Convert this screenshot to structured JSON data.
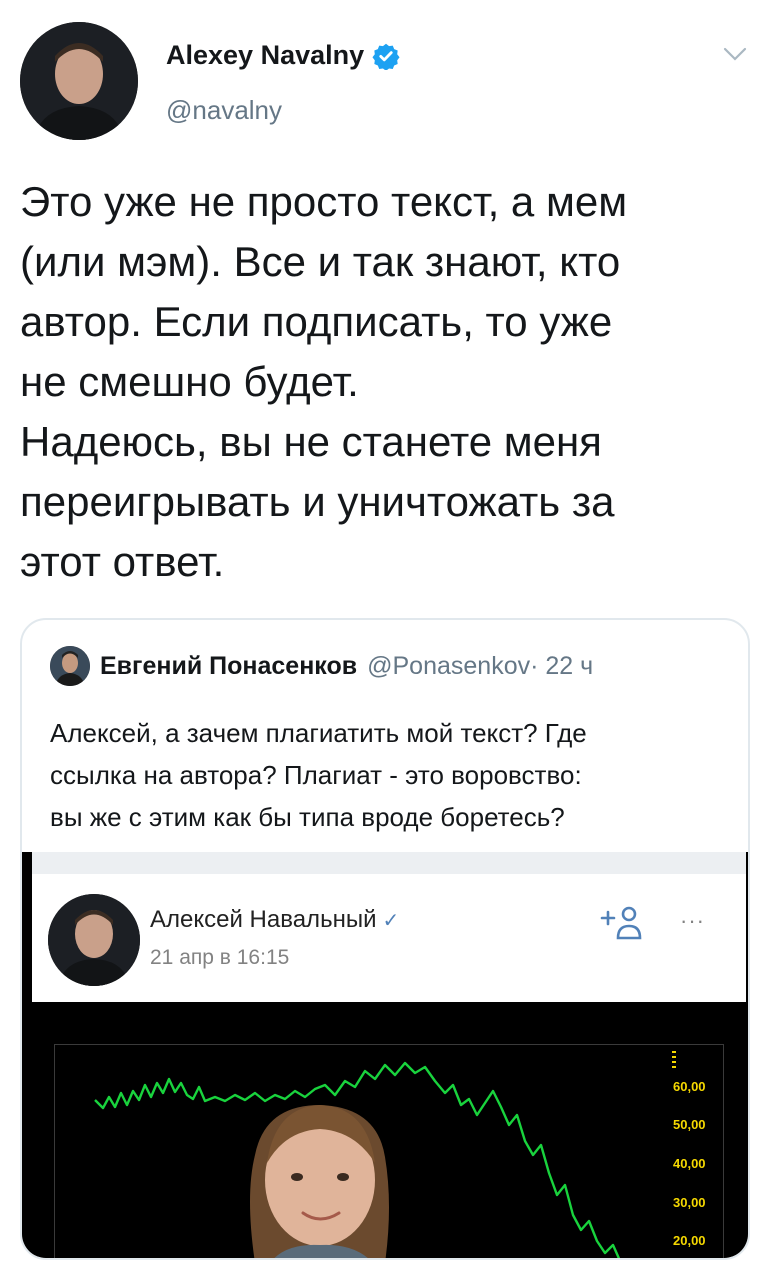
{
  "tweet": {
    "author_name": "Alexey Navalny",
    "author_handle": "@navalny",
    "text_lines": [
      "Это уже не просто текст, а мем",
      "(или мэм). Все и так знают, кто",
      "автор. Если подписать, то уже",
      "не смешно будет.",
      "Надеюсь, вы не станете меня",
      "переигрывать и уничтожать за",
      "этот ответ."
    ]
  },
  "quote": {
    "author_name": "Евгений Понасенков",
    "author_handle": "@Ponasenkov",
    "time": " · 22 ч",
    "text_lines": [
      "Алексей, а зачем плагиатить мой текст? Где",
      "ссылка на автора? Плагиат - это воровство:",
      "вы же с этим как бы типа вроде боретесь?"
    ]
  },
  "vk_post": {
    "author_name": "Алексей Навальный",
    "date": "21 апр в 16:15",
    "more": "···"
  },
  "chart_data": {
    "type": "line",
    "y_tick_labels": [
      "60,00",
      "50,00",
      "40,00",
      "30,00",
      "20,00"
    ],
    "line_color": "#19d33d",
    "label_color": "#f5d800"
  },
  "colors": {
    "verified_blue": "#1da1f2",
    "secondary_text": "#657786",
    "vk_blue": "#5181b8"
  }
}
